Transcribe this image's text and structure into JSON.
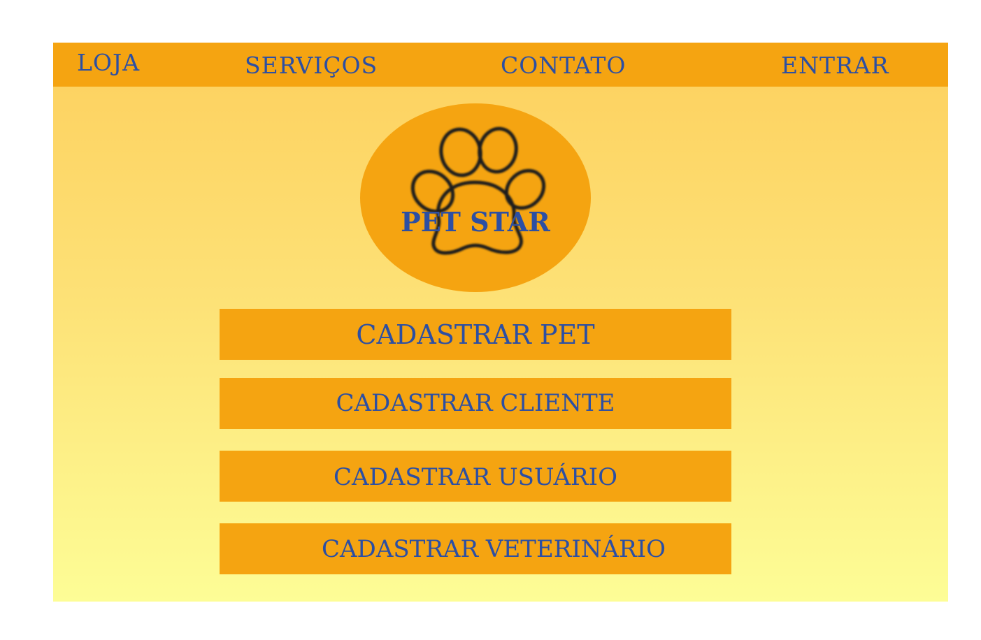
{
  "nav": {
    "items": [
      {
        "label": "LOJA"
      },
      {
        "label": "SERVIÇOS"
      },
      {
        "label": "CONTATO"
      },
      {
        "label": "ENTRAR"
      }
    ]
  },
  "logo": {
    "text": "PET STAR",
    "icon": "paw-icon"
  },
  "buttons": [
    {
      "label": "CADASTRAR PET"
    },
    {
      "label": "CADASTRAR CLIENTE"
    },
    {
      "label": "CADASTRAR USUÁRIO"
    },
    {
      "label": "CADASTRAR VETERINÁRIO"
    }
  ],
  "colors": {
    "accent": "#f5a411",
    "text": "#2c4fa3",
    "background_top": "#fdd05e",
    "background_bottom": "#fdfd96"
  }
}
